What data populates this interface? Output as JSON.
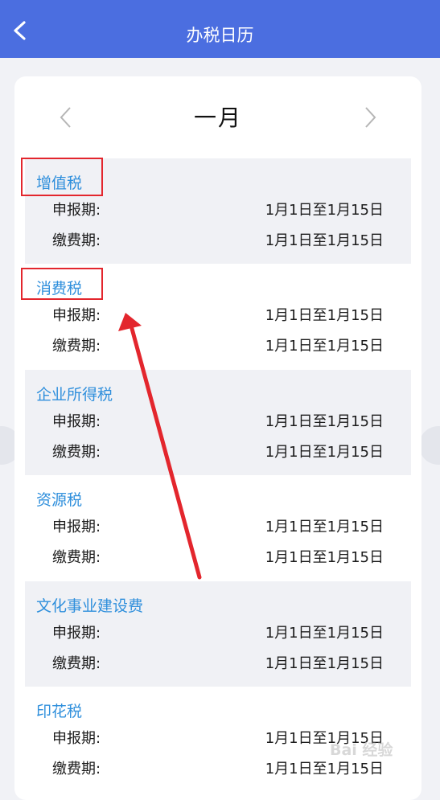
{
  "header": {
    "title": "办税日历"
  },
  "calendar": {
    "month": "一月"
  },
  "taxes": [
    {
      "name": "增值税",
      "filing_label": "申报期:",
      "filing_period": "1月1日至1月15日",
      "payment_label": "缴费期:",
      "payment_period": "1月1日至1月15日"
    },
    {
      "name": "消费税",
      "filing_label": "申报期:",
      "filing_period": "1月1日至1月15日",
      "payment_label": "缴费期:",
      "payment_period": "1月1日至1月15日"
    },
    {
      "name": "企业所得税",
      "filing_label": "申报期:",
      "filing_period": "1月1日至1月15日",
      "payment_label": "缴费期:",
      "payment_period": "1月1日至1月15日"
    },
    {
      "name": "资源税",
      "filing_label": "申报期:",
      "filing_period": "1月1日至1月15日",
      "payment_label": "缴费期:",
      "payment_period": "1月1日至1月15日"
    },
    {
      "name": "文化事业建设费",
      "filing_label": "申报期:",
      "filing_period": "1月1日至1月15日",
      "payment_label": "缴费期:",
      "payment_period": "1月1日至1月15日"
    },
    {
      "name": "印花税",
      "filing_label": "申报期:",
      "filing_period": "1月1日至1月15日",
      "payment_label": "缴费期:",
      "payment_period": "1月1日至1月15日"
    }
  ],
  "watermark": {
    "text": "Bai 经验"
  },
  "colors": {
    "navbar": "#4b6ee0",
    "tax_name": "#2f8fdc",
    "annotation": "#e3262d"
  }
}
